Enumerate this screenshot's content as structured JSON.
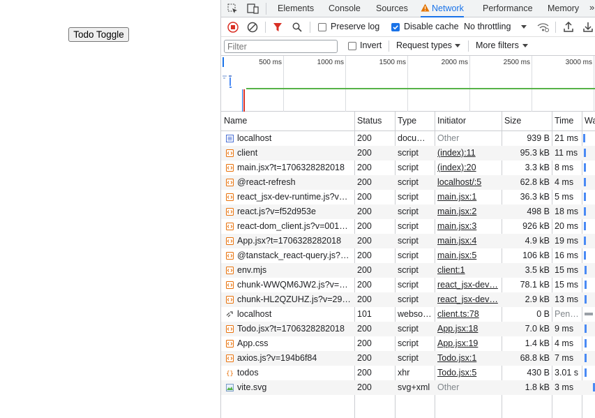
{
  "app": {
    "button_label": "Todo Toggle"
  },
  "tabs": [
    "Elements",
    "Console",
    "Sources",
    "Network",
    "Performance",
    "Memory"
  ],
  "active_tab": "Network",
  "toolbar": {
    "preserve_log": "Preserve log",
    "disable_cache": "Disable cache",
    "throttling": "No throttling"
  },
  "filter_bar": {
    "filter_placeholder": "Filter",
    "invert": "Invert",
    "request_types": "Request types",
    "more_filters": "More filters"
  },
  "overview": {
    "ticks": [
      "500 ms",
      "1000 ms",
      "1500 ms",
      "2000 ms",
      "2500 ms",
      "3000 ms"
    ]
  },
  "columns": [
    "Name",
    "Status",
    "Type",
    "Initiator",
    "Size",
    "Time",
    "Wa"
  ],
  "rows": [
    {
      "icon": "document-icon",
      "name": "localhost",
      "status": "200",
      "type": "docu…",
      "initiator": "Other",
      "init_link": false,
      "size": "939 B",
      "time": "21 ms",
      "wf": 0.02
    },
    {
      "icon": "script-icon",
      "name": "client",
      "status": "200",
      "type": "script",
      "initiator": "(index):11",
      "init_link": true,
      "size": "95.3 kB",
      "time": "11 ms",
      "wf": 0.05
    },
    {
      "icon": "script-icon",
      "name": "main.jsx?t=1706328282018",
      "status": "200",
      "type": "script",
      "initiator": "(index):20",
      "init_link": true,
      "size": "3.3 kB",
      "time": "8 ms",
      "wf": 0.05
    },
    {
      "icon": "script-icon",
      "name": "@react-refresh",
      "status": "200",
      "type": "script",
      "initiator": "localhost/:5",
      "init_link": true,
      "size": "62.8 kB",
      "time": "4 ms",
      "wf": 0.05
    },
    {
      "icon": "script-icon",
      "name": "react_jsx-dev-runtime.js?v=…",
      "status": "200",
      "type": "script",
      "initiator": "main.jsx:1",
      "init_link": true,
      "size": "36.3 kB",
      "time": "5 ms",
      "wf": 0.08
    },
    {
      "icon": "script-icon",
      "name": "react.js?v=f52d953e",
      "status": "200",
      "type": "script",
      "initiator": "main.jsx:2",
      "init_link": true,
      "size": "498 B",
      "time": "18 ms",
      "wf": 0.08
    },
    {
      "icon": "script-icon",
      "name": "react-dom_client.js?v=0014…",
      "status": "200",
      "type": "script",
      "initiator": "main.jsx:3",
      "init_link": true,
      "size": "926 kB",
      "time": "20 ms",
      "wf": 0.08
    },
    {
      "icon": "script-icon",
      "name": "App.jsx?t=1706328282018",
      "status": "200",
      "type": "script",
      "initiator": "main.jsx:4",
      "init_link": true,
      "size": "4.9 kB",
      "time": "19 ms",
      "wf": 0.08
    },
    {
      "icon": "script-icon",
      "name": "@tanstack_react-query.js?v…",
      "status": "200",
      "type": "script",
      "initiator": "main.jsx:5",
      "init_link": true,
      "size": "106 kB",
      "time": "16 ms",
      "wf": 0.08
    },
    {
      "icon": "script-icon",
      "name": "env.mjs",
      "status": "200",
      "type": "script",
      "initiator": "client:1",
      "init_link": true,
      "size": "3.5 kB",
      "time": "15 ms",
      "wf": 0.1
    },
    {
      "icon": "script-icon",
      "name": "chunk-WWQM6JW2.js?v=2…",
      "status": "200",
      "type": "script",
      "initiator": "react_jsx-dev…",
      "init_link": true,
      "size": "78.1 kB",
      "time": "15 ms",
      "wf": 0.1
    },
    {
      "icon": "script-icon",
      "name": "chunk-HL2QZUHZ.js?v=29…",
      "status": "200",
      "type": "script",
      "initiator": "react_jsx-dev…",
      "init_link": true,
      "size": "2.9 kB",
      "time": "13 ms",
      "wf": 0.1
    },
    {
      "icon": "websocket-icon",
      "name": "localhost",
      "status": "101",
      "type": "webso…",
      "initiator": "client.ts:78",
      "init_link": true,
      "size": "0 B",
      "time": "Pen…",
      "wf": 0.12
    },
    {
      "icon": "script-icon",
      "name": "Todo.jsx?t=1706328282018",
      "status": "200",
      "type": "script",
      "initiator": "App.jsx:18",
      "init_link": true,
      "size": "7.0 kB",
      "time": "9 ms",
      "wf": 0.12
    },
    {
      "icon": "script-icon",
      "name": "App.css",
      "status": "200",
      "type": "script",
      "initiator": "App.jsx:19",
      "init_link": true,
      "size": "1.4 kB",
      "time": "4 ms",
      "wf": 0.12
    },
    {
      "icon": "script-icon",
      "name": "axios.js?v=194b6f84",
      "status": "200",
      "type": "script",
      "initiator": "Todo.jsx:1",
      "init_link": true,
      "size": "68.8 kB",
      "time": "7 ms",
      "wf": 0.12
    },
    {
      "icon": "xhr-icon",
      "name": "todos",
      "status": "200",
      "type": "xhr",
      "initiator": "Todo.jsx:5",
      "init_link": true,
      "size": "430 B",
      "time": "3.01 s",
      "wf": 0.14
    },
    {
      "icon": "image-icon",
      "name": "vite.svg",
      "status": "200",
      "type": "svg+xml",
      "initiator": "Other",
      "init_link": false,
      "size": "1.8 kB",
      "time": "3 ms",
      "wf": 0.9
    }
  ],
  "colors": {
    "accent": "#1a73e8",
    "record": "#d93025",
    "filter_red": "#d93025",
    "timeline_green": "#56b248"
  }
}
